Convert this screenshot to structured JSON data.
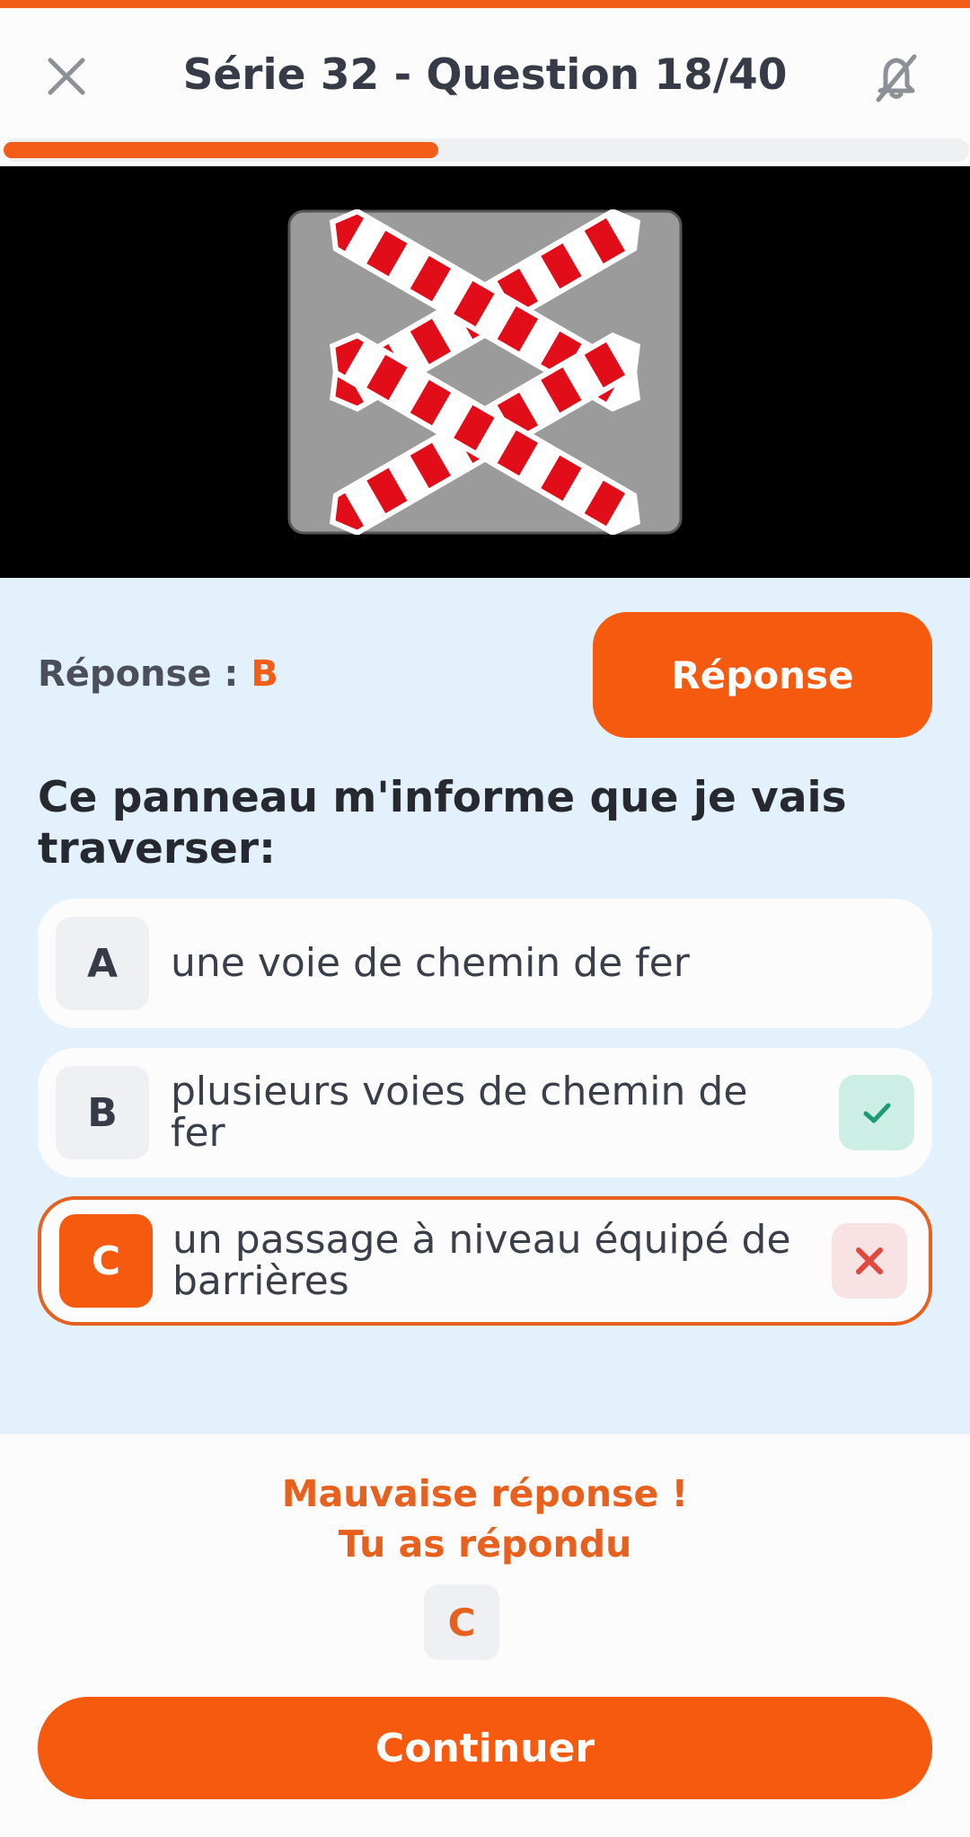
{
  "header": {
    "title": "Série 32 - Question 18/40",
    "close_icon": "close-icon",
    "mute_icon": "mute-icon"
  },
  "progress": {
    "current": 18,
    "total": 40,
    "fraction": 0.45
  },
  "media": {
    "sign_icon": "railroad-crossing-multiple-tracks-sign"
  },
  "answer": {
    "label": "Réponse :",
    "letter": "B",
    "button_label": "Réponse"
  },
  "question": {
    "text": "Ce panneau m'informe que je vais traverser:"
  },
  "options": [
    {
      "letter": "A",
      "text": "une voie de chemin de fer",
      "status": "none"
    },
    {
      "letter": "B",
      "text": "plusieurs voies de chemin de fer",
      "status": "correct"
    },
    {
      "letter": "C",
      "text": "un passage à niveau équipé de barrières",
      "status": "wrong",
      "selected": true
    }
  ],
  "feedback": {
    "headline": "Mauvaise réponse !",
    "subline": "Tu as répondu",
    "given_letter": "C"
  },
  "footer": {
    "continue_label": "Continuer"
  },
  "colors": {
    "accent": "#f65a0f",
    "panel_bg": "#e3f1fd",
    "correct_bg": "#cdeee4",
    "correct_fg": "#1f9a78",
    "wrong_bg": "#f8e2e4",
    "wrong_fg": "#e0483d"
  }
}
